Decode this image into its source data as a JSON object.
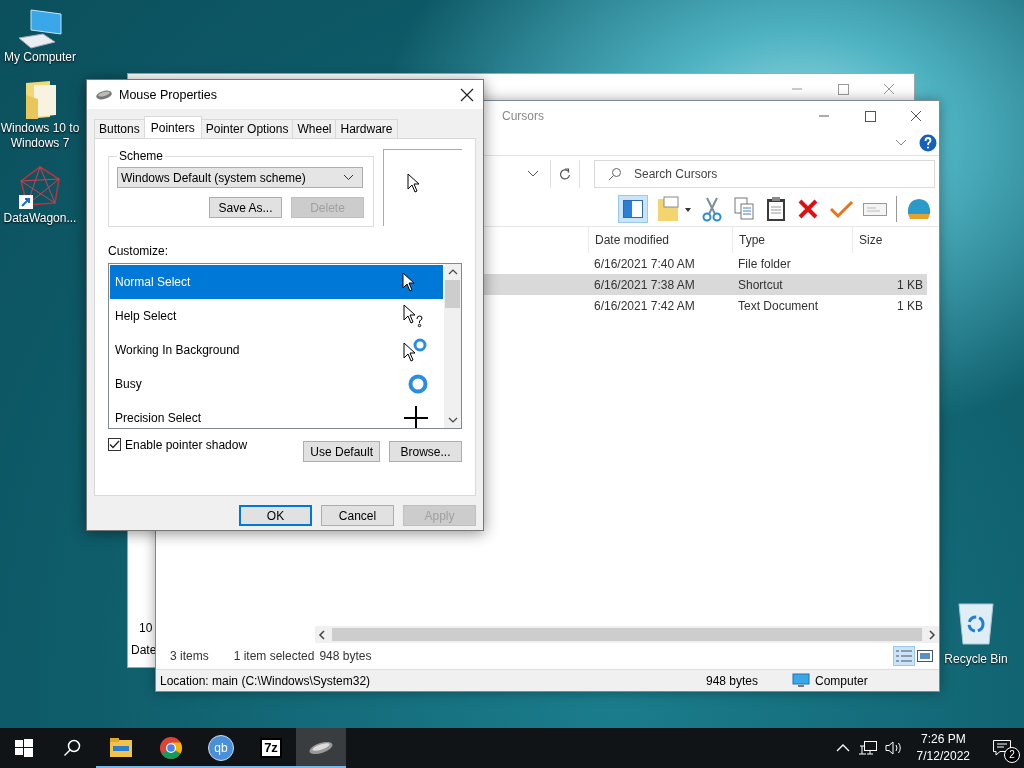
{
  "desktop_icons": [
    {
      "label": "My Computer",
      "kind": "computer"
    },
    {
      "label": "Windows 10 to Windows 7",
      "kind": "folder"
    },
    {
      "label": "DataWagon...",
      "kind": "network"
    }
  ],
  "recycle_bin": {
    "label": "Recycle Bin"
  },
  "background_window": {
    "cells": [
      "10",
      "Date"
    ]
  },
  "explorer": {
    "title": "Cursors",
    "search": {
      "placeholder": "Search Cursors"
    },
    "columns": [
      "Date modified",
      "Type",
      "Size"
    ],
    "rows": [
      {
        "date": "6/16/2021 7:40 AM",
        "type": "File folder",
        "size": "",
        "selected": false
      },
      {
        "date": "6/16/2021 7:38 AM",
        "type": "Shortcut",
        "size": "1 KB",
        "selected": true
      },
      {
        "date": "6/16/2021 7:42 AM",
        "type": "Text Document",
        "size": "1 KB",
        "selected": false
      }
    ],
    "status": {
      "items": "3 items",
      "selection": "1 item selected",
      "bytes": "948 bytes"
    },
    "status_bar": {
      "location": "Location: main (C:\\Windows\\System32)",
      "size": "948 bytes",
      "zone": "Computer"
    }
  },
  "dialog": {
    "title": "Mouse Properties",
    "tabs": [
      {
        "label": "Buttons",
        "selected": false
      },
      {
        "label": "Pointers",
        "selected": true
      },
      {
        "label": "Pointer Options",
        "selected": false
      },
      {
        "label": "Wheel",
        "selected": false
      },
      {
        "label": "Hardware",
        "selected": false
      }
    ],
    "scheme": {
      "label": "Scheme",
      "value": "Windows Default (system scheme)",
      "buttons": [
        {
          "label": "Save As...",
          "disabled": false
        },
        {
          "label": "Delete",
          "disabled": true
        }
      ]
    },
    "customize_label": "Customize:",
    "pointers": [
      {
        "name": "Normal Select",
        "kind": "arrow",
        "selected": true
      },
      {
        "name": "Help Select",
        "kind": "help",
        "selected": false
      },
      {
        "name": "Working In Background",
        "kind": "working",
        "selected": false
      },
      {
        "name": "Busy",
        "kind": "busy",
        "selected": false
      },
      {
        "name": "Precision Select",
        "kind": "precision",
        "selected": false
      }
    ],
    "shadow": {
      "label": "Enable pointer shadow",
      "checked": true
    },
    "list_buttons": [
      "Use Default",
      "Browse..."
    ],
    "buttons": [
      {
        "label": "OK",
        "default": true,
        "disabled": false
      },
      {
        "label": "Cancel",
        "default": false,
        "disabled": false
      },
      {
        "label": "Apply",
        "default": false,
        "disabled": true
      }
    ]
  },
  "taskbar": {
    "apps": [
      {
        "kind": "explorer",
        "running": true,
        "active": false
      },
      {
        "kind": "chrome",
        "running": true,
        "active": false
      },
      {
        "kind": "qbittorrent",
        "label": "qb",
        "running": true,
        "active": false
      },
      {
        "kind": "sevenzip",
        "label": "7z",
        "running": true,
        "active": false
      },
      {
        "kind": "mouse",
        "running": true,
        "active": true
      }
    ],
    "time": "7:26 PM",
    "date": "7/12/2022",
    "notifications": "2"
  }
}
